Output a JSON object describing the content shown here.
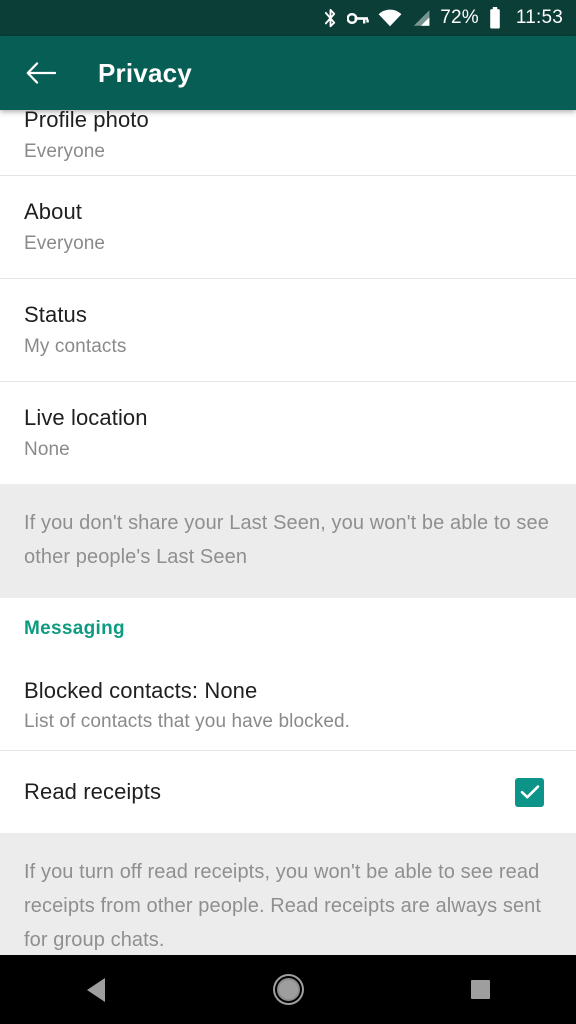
{
  "statusbar": {
    "icons": [
      "bluetooth-icon",
      "vpn-key-icon",
      "wifi-icon",
      "cellular-signal-icon",
      "battery-icon"
    ],
    "battery_percent": "72%",
    "time": "11:53"
  },
  "appbar": {
    "back_icon": "back-arrow-icon",
    "title": "Privacy",
    "background_color": "#075e54"
  },
  "settings": {
    "profile_photo": {
      "title": "Profile photo",
      "value": "Everyone"
    },
    "about": {
      "title": "About",
      "value": "Everyone"
    },
    "status": {
      "title": "Status",
      "value": "My contacts"
    },
    "live_location": {
      "title": "Live location",
      "value": "None"
    }
  },
  "last_seen_note": "If you don't share your Last Seen, you won't be able to see other people's Last Seen",
  "messaging": {
    "header": "Messaging",
    "header_color": "#0f9b81",
    "blocked_contacts": {
      "title": "Blocked contacts: None",
      "subtitle": "List of contacts that you have blocked."
    },
    "read_receipts": {
      "title": "Read receipts",
      "checked": true,
      "checkbox_color": "#0d9488",
      "check_icon": "checkmark-icon"
    },
    "read_receipts_note": "If you turn off read receipts, you won't be able to see read receipts from other people. Read receipts are always sent for group chats."
  },
  "navbar": {
    "back": "nav-back-icon",
    "home": "nav-home-icon",
    "recents": "nav-recents-icon"
  }
}
